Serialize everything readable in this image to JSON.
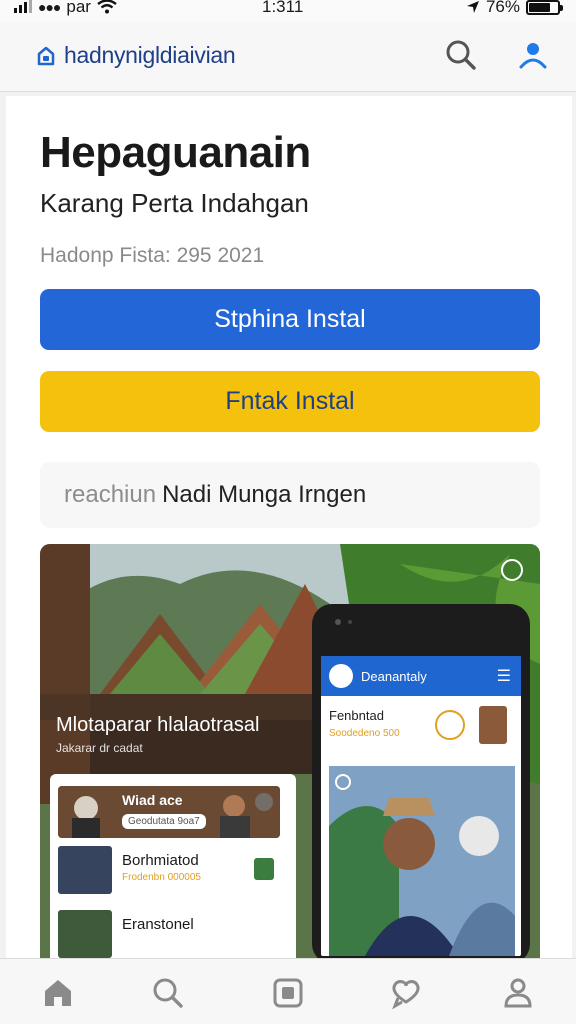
{
  "status_bar": {
    "carrier": "par",
    "time": "1:311",
    "battery": "76%",
    "battery_level": 0.76
  },
  "header": {
    "brand": "hadnynigldiaivian"
  },
  "hero": {
    "title": "Hepaguanain",
    "subtitle": "Karang Perta Indahgan",
    "meta": "Hadonp Fista: 295 2021"
  },
  "buttons": {
    "primary": "Stphina Instal",
    "secondary": "Fntak Instal"
  },
  "search": {
    "placeholder": "reachiun",
    "value": "Nadi Munga  Irngen"
  },
  "showcase": {
    "caption": "Mlotaparar hlalaotrasal",
    "caption_sub": "Jakarar dr cadat",
    "list": [
      {
        "name": "Wiad ace",
        "sub": "Geodutata 9oa7"
      },
      {
        "name": "Borhmiatod",
        "sub": "Frodenbn 000005"
      },
      {
        "name": "Eranstonel",
        "sub": ""
      }
    ],
    "phone": {
      "app_title": "Deanantaly",
      "row_title": "Fenbntad",
      "row_sub": "Soodedeno 500"
    }
  },
  "colors": {
    "primary": "#2366d8",
    "secondary": "#f4c20d",
    "brand": "#1f3f86"
  },
  "icons": {
    "header": [
      "lock-house-icon",
      "search-icon",
      "user-icon"
    ],
    "tabs": [
      "home-icon",
      "search-icon",
      "news-icon",
      "chat-heart-icon",
      "profile-icon"
    ]
  }
}
